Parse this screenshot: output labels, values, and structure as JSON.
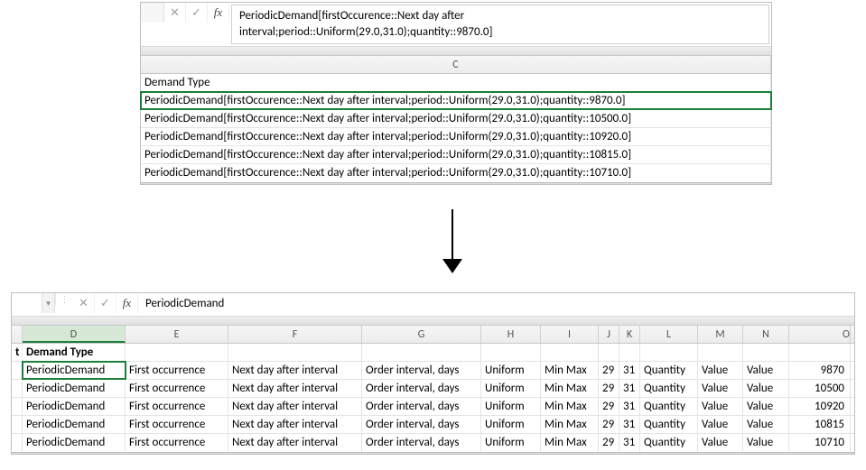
{
  "top": {
    "formula_line1": "PeriodicDemand[firstOccurence::Next day after",
    "formula_line2": "interval;period::Uniform(29.0,31.0);quantity::9870.0]",
    "col_label": "C",
    "header": "Demand Type",
    "rows": [
      "PeriodicDemand[firstOccurence::Next day after interval;period::Uniform(29.0,31.0);quantity::9870.0]",
      "PeriodicDemand[firstOccurence::Next day after interval;period::Uniform(29.0,31.0);quantity::10500.0]",
      "PeriodicDemand[firstOccurence::Next day after interval;period::Uniform(29.0,31.0);quantity::10920.0]",
      "PeriodicDemand[firstOccurence::Next day after interval;period::Uniform(29.0,31.0);quantity::10815.0]",
      "PeriodicDemand[firstOccurence::Next day after interval;period::Uniform(29.0,31.0);quantity::10710.0]"
    ]
  },
  "bottom": {
    "fx_label": "fx",
    "formula_value": "PeriodicDemand",
    "col_labels": {
      "D": "D",
      "E": "E",
      "F": "F",
      "G": "G",
      "H": "H",
      "I": "I",
      "J": "J",
      "K": "K",
      "L": "L",
      "M": "M",
      "N": "N",
      "O": "O"
    },
    "header": {
      "t": "t",
      "D": "Demand Type"
    },
    "rows": [
      {
        "D": "PeriodicDemand",
        "E": "First occurrence",
        "F": "Next day after interval",
        "G": "Order interval, days",
        "H": "Uniform",
        "I": "Min Max",
        "J": "29",
        "K": "31",
        "L": "Quantity",
        "M": "Value",
        "N": "Value",
        "O": "9870"
      },
      {
        "D": "PeriodicDemand",
        "E": "First occurrence",
        "F": "Next day after interval",
        "G": "Order interval, days",
        "H": "Uniform",
        "I": "Min Max",
        "J": "29",
        "K": "31",
        "L": "Quantity",
        "M": "Value",
        "N": "Value",
        "O": "10500"
      },
      {
        "D": "PeriodicDemand",
        "E": "First occurrence",
        "F": "Next day after interval",
        "G": "Order interval, days",
        "H": "Uniform",
        "I": "Min Max",
        "J": "29",
        "K": "31",
        "L": "Quantity",
        "M": "Value",
        "N": "Value",
        "O": "10920"
      },
      {
        "D": "PeriodicDemand",
        "E": "First occurrence",
        "F": "Next day after interval",
        "G": "Order interval, days",
        "H": "Uniform",
        "I": "Min Max",
        "J": "29",
        "K": "31",
        "L": "Quantity",
        "M": "Value",
        "N": "Value",
        "O": "10815"
      },
      {
        "D": "PeriodicDemand",
        "E": "First occurrence",
        "F": "Next day after interval",
        "G": "Order interval, days",
        "H": "Uniform",
        "I": "Min Max",
        "J": "29",
        "K": "31",
        "L": "Quantity",
        "M": "Value",
        "N": "Value",
        "O": "10710"
      }
    ]
  },
  "icons": {
    "fx": "fx",
    "cancel_glyph": "✕",
    "enter_glyph": "✓",
    "dropdown_glyph": "▾",
    "menu_dots": "⋮"
  }
}
